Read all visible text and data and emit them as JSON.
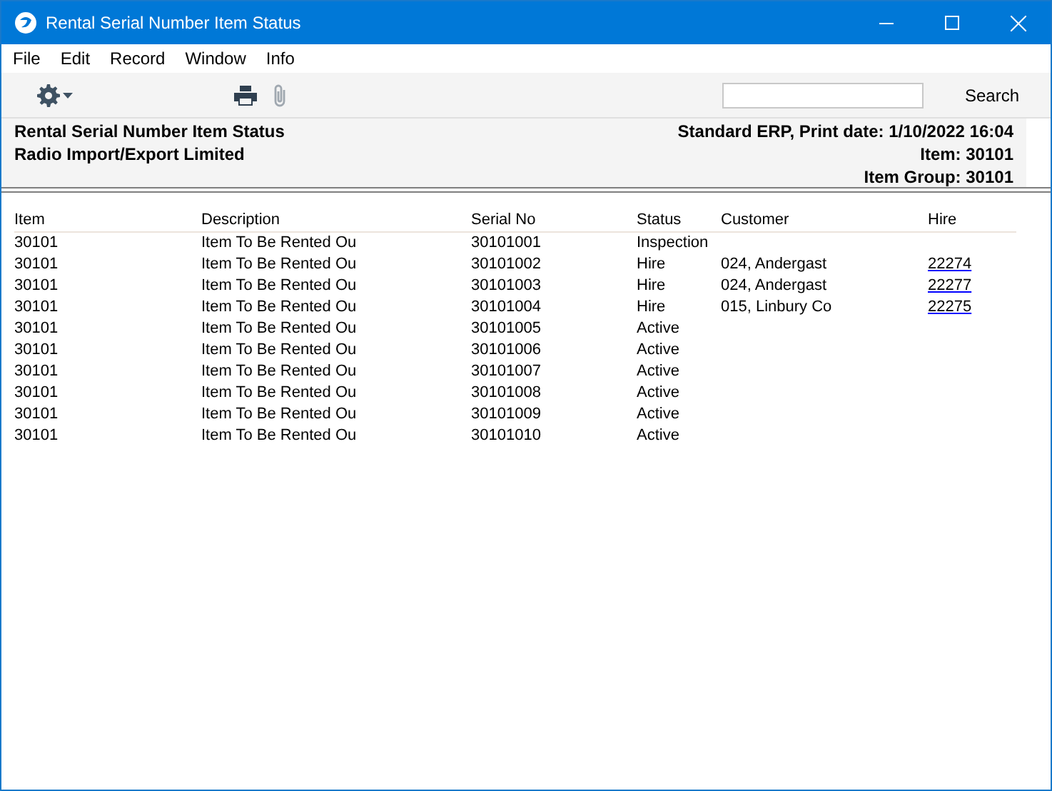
{
  "window": {
    "title": "Rental Serial Number Item Status"
  },
  "menu": [
    "File",
    "Edit",
    "Record",
    "Window",
    "Info"
  ],
  "toolbar": {
    "search_button": "Search"
  },
  "report_header": {
    "title": "Rental Serial Number Item Status",
    "company": "Radio Import/Export Limited",
    "print_info": "Standard ERP, Print date: 1/10/2022 16:04",
    "item": "Item: 30101",
    "item_group": "Item Group: 30101"
  },
  "table": {
    "columns": [
      "Item",
      "Description",
      "Serial No",
      "Status",
      "Customer",
      "Hire"
    ],
    "rows": [
      {
        "item": "30101",
        "description": "Item To Be Rented Ou",
        "serial_no": "30101001",
        "status": "Inspection"
      },
      {
        "item": "30101",
        "description": "Item To Be Rented Ou",
        "serial_no": "30101002",
        "status": "Hire",
        "customer": "024, Andergast",
        "hire": "22274"
      },
      {
        "item": "30101",
        "description": "Item To Be Rented Ou",
        "serial_no": "30101003",
        "status": "Hire",
        "customer": "024, Andergast",
        "hire": "22277"
      },
      {
        "item": "30101",
        "description": "Item To Be Rented Ou",
        "serial_no": "30101004",
        "status": "Hire",
        "customer": "015, Linbury Co",
        "hire": "22275"
      },
      {
        "item": "30101",
        "description": "Item To Be Rented Ou",
        "serial_no": "30101005",
        "status": "Active"
      },
      {
        "item": "30101",
        "description": "Item To Be Rented Ou",
        "serial_no": "30101006",
        "status": "Active"
      },
      {
        "item": "30101",
        "description": "Item To Be Rented Ou",
        "serial_no": "30101007",
        "status": "Active"
      },
      {
        "item": "30101",
        "description": "Item To Be Rented Ou",
        "serial_no": "30101008",
        "status": "Active"
      },
      {
        "item": "30101",
        "description": "Item To Be Rented Ou",
        "serial_no": "30101009",
        "status": "Active"
      },
      {
        "item": "30101",
        "description": "Item To Be Rented Ou",
        "serial_no": "30101010",
        "status": "Active"
      }
    ]
  }
}
